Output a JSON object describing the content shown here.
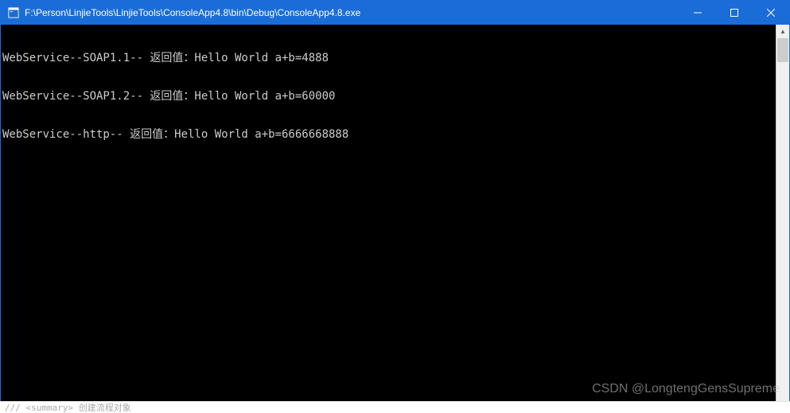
{
  "window": {
    "title": "F:\\Person\\LinjieTools\\LinjieTools\\ConsoleApp4.8\\bin\\Debug\\ConsoleApp4.8.exe",
    "icon": "console-app-icon"
  },
  "controls": {
    "minimize": "─",
    "maximize": "☐",
    "close": "✕"
  },
  "console": {
    "lines": [
      "WebService--SOAP1.1-- 返回值：Hello World a+b=4888",
      "WebService--SOAP1.2-- 返回值：Hello World a+b=60000",
      "WebService--http-- 返回值：Hello World a+b=6666668888"
    ]
  },
  "scrollbar": {
    "up": "▲",
    "down": "▼"
  },
  "watermark": "CSDN @LongtengGensSupreme",
  "bottom_text": "/// <summary> 创建流程对象"
}
